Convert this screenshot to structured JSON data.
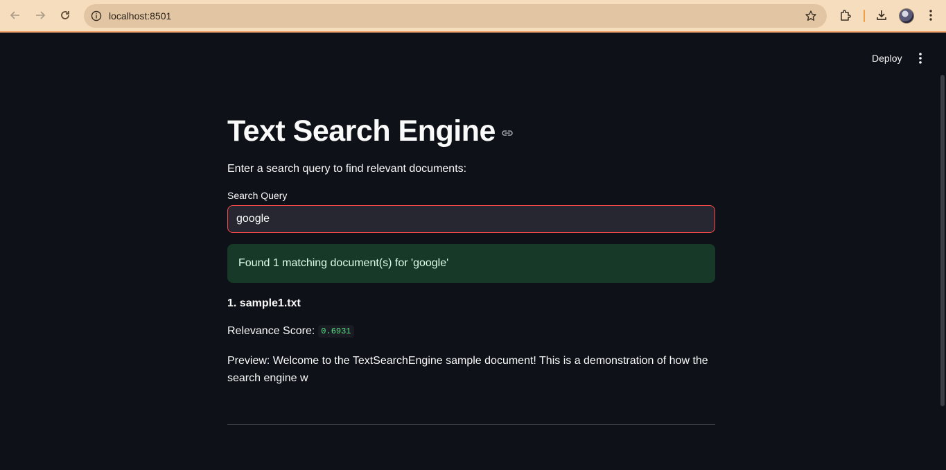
{
  "browser": {
    "url": "localhost:8501"
  },
  "app_header": {
    "deploy_label": "Deploy"
  },
  "main": {
    "title": "Text Search Engine",
    "intro": "Enter a search query to find relevant documents:",
    "search": {
      "label": "Search Query",
      "value": "google"
    },
    "alert": {
      "text": "Found 1 matching document(s) for 'google'"
    },
    "results": [
      {
        "title": "1. sample1.txt",
        "score_label": "Relevance Score:",
        "score": "0.6931",
        "preview": "Preview: Welcome to the TextSearchEngine sample document! This is a demonstration of how the search engine w"
      }
    ]
  },
  "colors": {
    "background": "#0e1117",
    "input_border_focus": "#ff4b4b",
    "alert_background": "#173928",
    "score_text": "#5ce488",
    "chrome_background": "#f6ddbd"
  },
  "icons": [
    "back-icon",
    "forward-icon",
    "reload-icon",
    "info-icon",
    "star-icon",
    "extensions-icon",
    "download-icon",
    "profile-avatar",
    "chrome-menu-icon",
    "app-menu-icon",
    "anchor-link-icon"
  ]
}
